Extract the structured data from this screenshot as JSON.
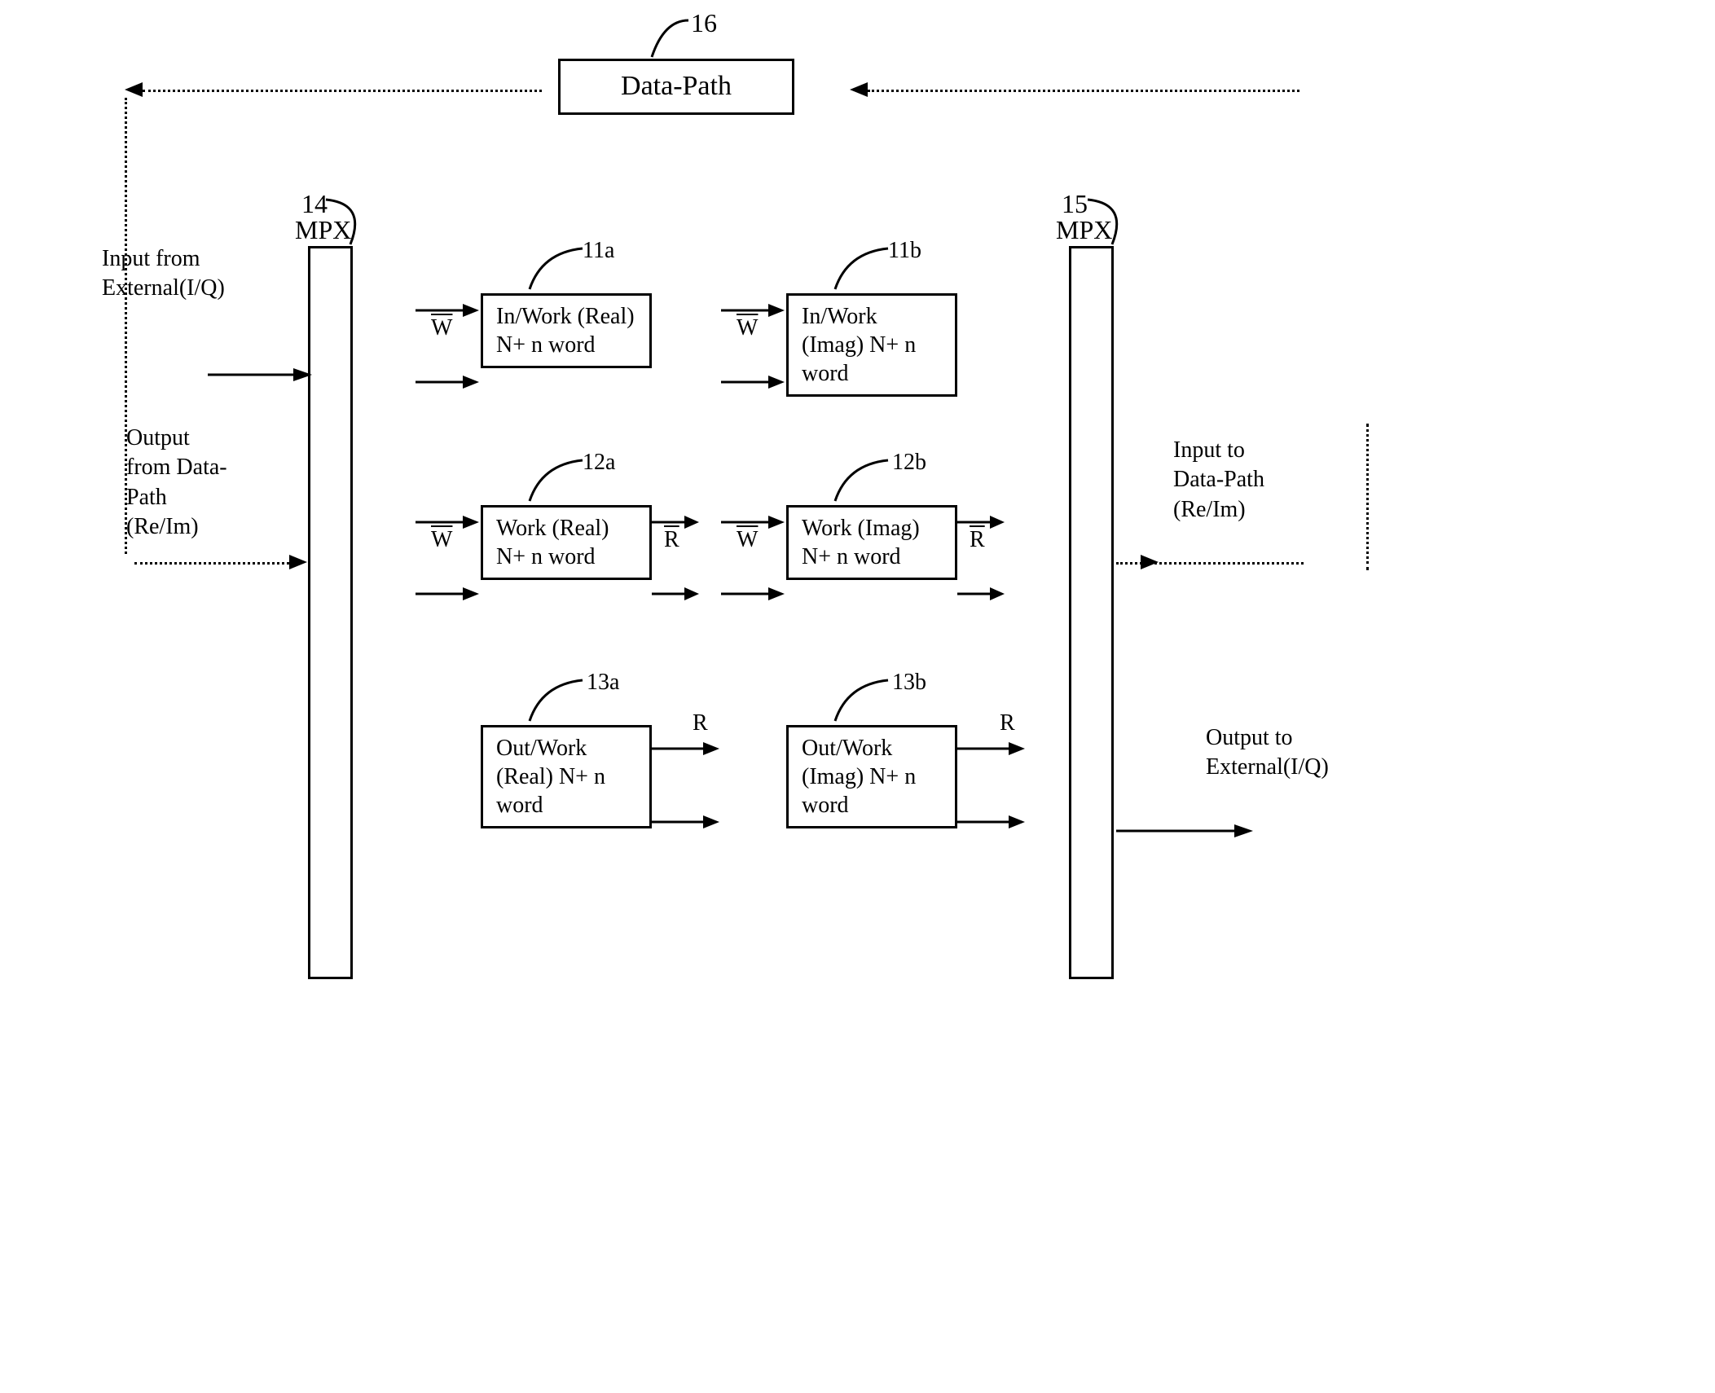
{
  "refs": {
    "top": "16",
    "mpx_left": "14",
    "mpx_right": "15",
    "r11a": "11a",
    "r11b": "11b",
    "r12a": "12a",
    "r12b": "12b",
    "r13a": "13a",
    "r13b": "13b"
  },
  "blocks": {
    "data_path": "Data-Path",
    "mpx_label_left": "MPX",
    "mpx_label_right": "MPX",
    "b11a": "In/Work\n(Real)\nN+ n word",
    "b11b": "In/Work\n(Imag)\nN+ n word",
    "b12a": "Work\n(Real)\nN+ n word",
    "b12b": "Work\n(Imag)\nN+ n word",
    "b13a": "Out/Work\n(Real)\nN+ n word",
    "b13b": "Out/Work\n(Imag)\nN+ n word"
  },
  "side_labels": {
    "in_ext": "Input from\nExternal(I/Q)",
    "out_dp": "Output\nfrom Data-\nPath\n(Re/Im)",
    "in_dp": "Input to\nData-Path\n(Re/Im)",
    "out_ext": "Output to\nExternal(I/Q)"
  },
  "port_labels": {
    "W": "W",
    "R": "R"
  }
}
